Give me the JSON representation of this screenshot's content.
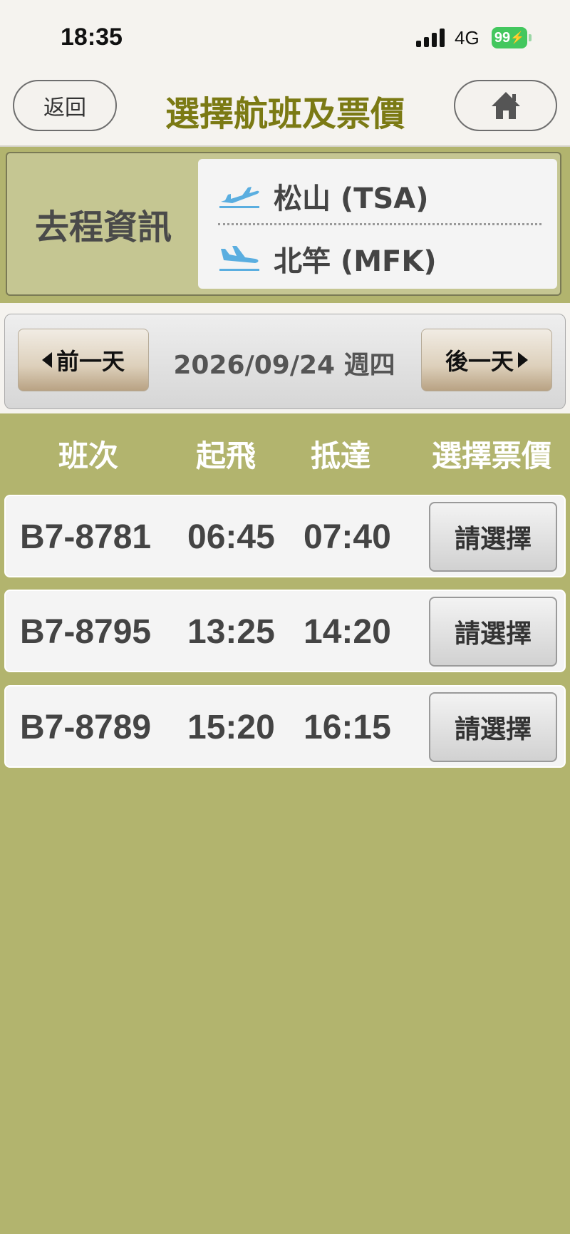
{
  "status_bar": {
    "time": "18:35",
    "network": "4G",
    "battery": "99"
  },
  "header": {
    "back_label": "返回",
    "title": "選擇航班及票價",
    "home_icon": "home-icon"
  },
  "route": {
    "label": "去程資訊",
    "origin": "松山 (TSA)",
    "destination": "北竿 (MFK)",
    "origin_icon": "takeoff-icon",
    "destination_icon": "landing-icon"
  },
  "date_bar": {
    "prev_label": "前一天",
    "date": "2026/09/24 週四",
    "next_label": "後一天"
  },
  "table": {
    "headers": [
      "班次",
      "起飛",
      "抵達",
      "選擇票價"
    ],
    "rows": [
      {
        "flight": "B7-8781",
        "depart": "06:45",
        "arrive": "07:40",
        "action": "請選擇"
      },
      {
        "flight": "B7-8795",
        "depart": "13:25",
        "arrive": "14:20",
        "action": "請選擇"
      },
      {
        "flight": "B7-8789",
        "depart": "15:20",
        "arrive": "16:15",
        "action": "請選擇"
      }
    ]
  },
  "colors": {
    "title": "#7b7a14",
    "background": "#b2b46e",
    "route_box": "#c5c692",
    "plane_icon": "#5aaee0",
    "battery": "#43c75e"
  }
}
